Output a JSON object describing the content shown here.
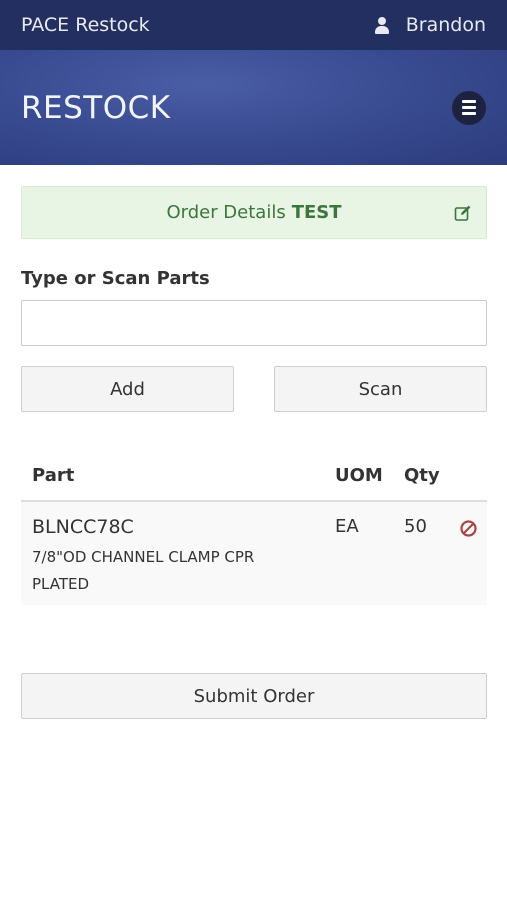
{
  "header": {
    "app_title": "PACE Restock",
    "user_name": "Brandon",
    "user_icon": "user-icon"
  },
  "banner": {
    "title": "RESTOCK",
    "menu_icon": "hamburger-menu-icon"
  },
  "order": {
    "label": "Order Details",
    "value": "TEST",
    "edit_icon": "edit-icon"
  },
  "parts_entry": {
    "label": "Type or Scan Parts",
    "input_value": "",
    "add_label": "Add",
    "scan_label": "Scan"
  },
  "table": {
    "columns": [
      "Part",
      "UOM",
      "Qty"
    ],
    "rows": [
      {
        "part": "BLNCC78C",
        "description": "7/8\"OD CHANNEL CLAMP CPR PLATED",
        "uom": "EA",
        "qty": "50",
        "remove_icon": "remove-icon"
      }
    ]
  },
  "footer": {
    "submit_label": "Submit Order"
  },
  "colors": {
    "topbar": "#232f60",
    "banner": "#3a4c92",
    "alert_bg": "#e8f4e4",
    "alert_text": "#3c763d",
    "remove_icon": "#a94442"
  }
}
